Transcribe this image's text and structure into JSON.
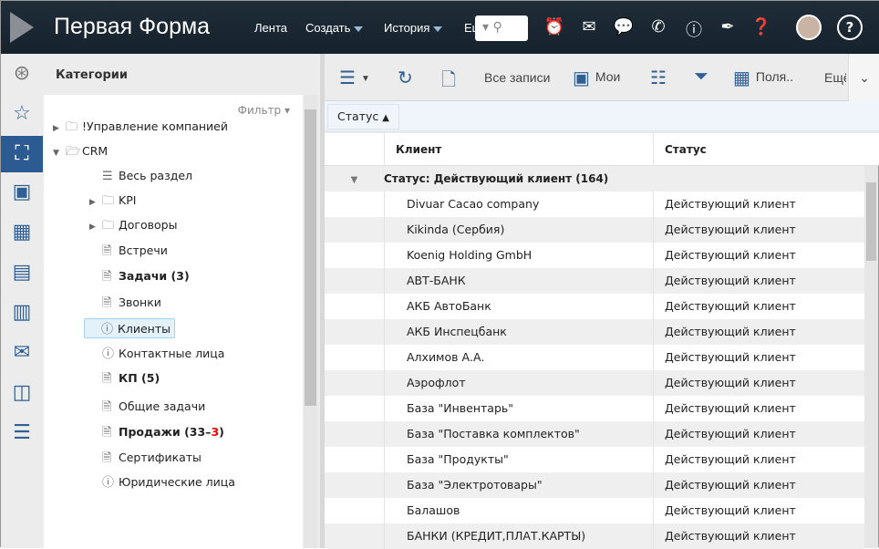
{
  "header": {
    "brand": "Первая Форма",
    "nav": [
      "Лента",
      "Создать",
      "История",
      "Ещё"
    ],
    "search_icon": "search-icon",
    "icons": [
      "alarm-clock-icon",
      "mail-icon",
      "chat-icon",
      "phone-icon",
      "alert-icon",
      "pen-icon",
      "question-bubble-icon"
    ],
    "help": "?"
  },
  "rail": [
    "pin-icon",
    "star-icon",
    "categories-icon",
    "contact-card-icon",
    "calendar-icon",
    "id-card-icon",
    "bar-chart-icon",
    "mail-icon",
    "outlook-icon",
    "cabinet-icon"
  ],
  "categories": {
    "title": "Категории",
    "filter": "Фильтр",
    "items": [
      {
        "label": "!Управление компанией",
        "type": "folder",
        "arrow": "▶",
        "level": 0
      },
      {
        "label": "CRM",
        "type": "folder-open",
        "arrow": "▼",
        "level": 0
      },
      {
        "label": "Весь раздел",
        "type": "list",
        "level": 1
      },
      {
        "label": "KPI",
        "type": "folder",
        "arrow": "▶",
        "level": 1
      },
      {
        "label": "Договоры",
        "type": "folder",
        "arrow": "▶",
        "level": 1
      },
      {
        "label": "Встречи",
        "type": "doc",
        "level": 1
      },
      {
        "label": "Задачи (3)",
        "type": "doc",
        "level": 1,
        "bold": true
      },
      {
        "label": "Звонки",
        "type": "doc",
        "level": 1
      },
      {
        "label": "Клиенты",
        "type": "info",
        "level": 1,
        "selected": true
      },
      {
        "label": "Контактные лица",
        "type": "info",
        "level": 1
      },
      {
        "label": "КП (5)",
        "type": "doc",
        "level": 1,
        "bold": true
      },
      {
        "label": "Общие задачи",
        "type": "doc",
        "level": 1
      },
      {
        "label": "Продажи (33–",
        "suffix_red": "3",
        "suffix": ")",
        "type": "doc",
        "level": 1,
        "bold": true
      },
      {
        "label": "Сертификаты",
        "type": "doc",
        "level": 1
      },
      {
        "label": "Юридические лица",
        "type": "info",
        "level": 1
      }
    ]
  },
  "toolbar": {
    "all_records": "Все записи",
    "mine": "Мои",
    "fields": "Поля..",
    "more": "Ещё"
  },
  "grouping": {
    "chip": "Статус"
  },
  "table": {
    "columns": [
      "Клиент",
      "Статус"
    ],
    "group_label": "Статус: Действующий клиент (164)",
    "rows": [
      [
        "Divuar Cacao company",
        "Действующий клиент"
      ],
      [
        "Kikinda (Сербия)",
        "Действующий клиент"
      ],
      [
        "Koenig Holding GmbH",
        "Действующий клиент"
      ],
      [
        "АВТ-БАНК",
        "Действующий клиент"
      ],
      [
        "АКБ АвтоБанк",
        "Действующий клиент"
      ],
      [
        "АКБ Инспецбанк",
        "Действующий клиент"
      ],
      [
        "Алхимов А.А.",
        "Действующий клиент"
      ],
      [
        "Аэрофлот",
        "Действующий клиент"
      ],
      [
        "База \"Инвентарь\"",
        "Действующий клиент"
      ],
      [
        "База \"Поставка комплектов\"",
        "Действующий клиент"
      ],
      [
        "База \"Продукты\"",
        "Действующий клиент"
      ],
      [
        "База \"Электротовары\"",
        "Действующий клиент"
      ],
      [
        "Балашов",
        "Действующий клиент"
      ],
      [
        "БАНКИ (КРЕДИТ,ПЛАТ.КАРТЫ)",
        "Действующий клиент"
      ]
    ]
  }
}
